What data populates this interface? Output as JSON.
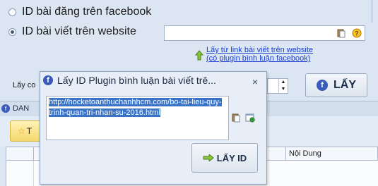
{
  "options": {
    "facebook_post_label": "ID bài đăng trên facebook",
    "website_post_label": "ID bài viết trên website"
  },
  "website_link": {
    "line1": "Lấy từ link bài viết trên website",
    "line2": "(có plugin bình luận facebook)"
  },
  "background": {
    "lay_prefix": "Lấy co",
    "lay_button": "LẤY",
    "tab_partial": "DAN",
    "button_partial": "T",
    "column_header": "Nội Dung"
  },
  "dialog": {
    "title": "Lấy ID Plugin bình luận bài viết trê...",
    "close": "×",
    "url_text": "http://hocketoanthuchanhhcm.com/bo-tai-lieu-quy-trinh-quan-tri-nhan-su-2016.html",
    "button_label": "LẤY ID"
  },
  "colors": {
    "accent": "#3a73c6",
    "link": "#1a3fd1",
    "facebook": "#3b5bb8"
  }
}
